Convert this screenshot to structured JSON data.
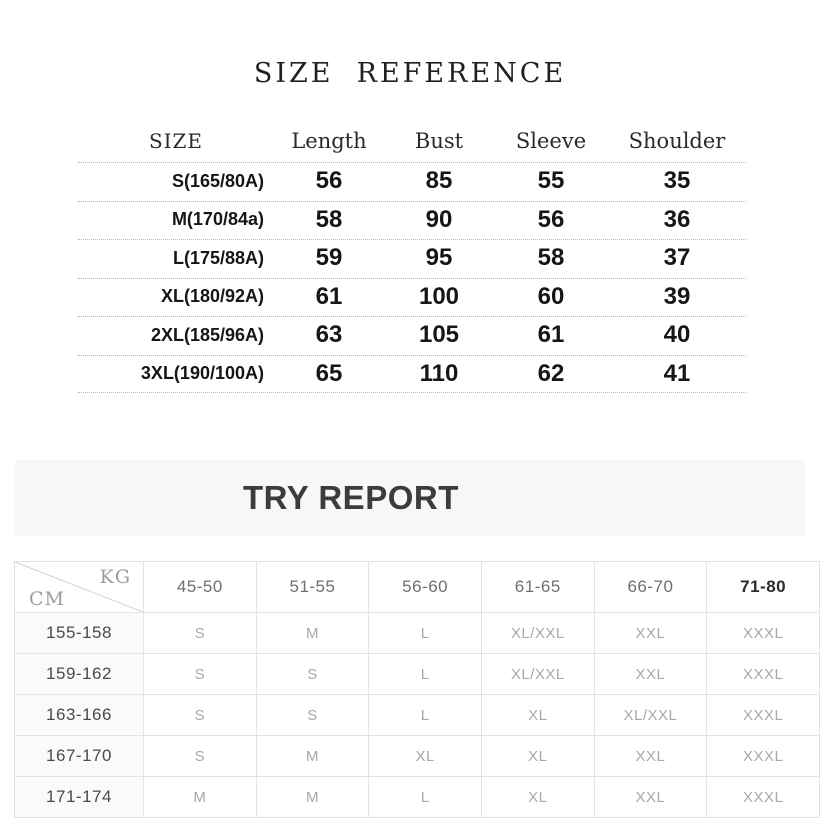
{
  "size_reference": {
    "title": "SIZE  REFERENCE",
    "columns": [
      "SIZE",
      "Length",
      "Bust",
      "Sleeve",
      "Shoulder"
    ],
    "rows": [
      {
        "size": "S(165/80A)",
        "length": "56",
        "bust": "85",
        "sleeve": "55",
        "shoulder": "35"
      },
      {
        "size": "M(170/84a)",
        "length": "58",
        "bust": "90",
        "sleeve": "56",
        "shoulder": "36"
      },
      {
        "size": "L(175/88A)",
        "length": "59",
        "bust": "95",
        "sleeve": "58",
        "shoulder": "37"
      },
      {
        "size": "XL(180/92A)",
        "length": "61",
        "bust": "100",
        "sleeve": "60",
        "shoulder": "39"
      },
      {
        "size": "2XL(185/96A)",
        "length": "63",
        "bust": "105",
        "sleeve": "61",
        "shoulder": "40"
      },
      {
        "size": "3XL(190/100A)",
        "length": "65",
        "bust": "110",
        "sleeve": "62",
        "shoulder": "41"
      }
    ]
  },
  "try_report": {
    "title": "TRY REPORT",
    "corner": {
      "weight_unit": "KG",
      "height_unit": "CM"
    },
    "weight_ranges": [
      "45-50",
      "51-55",
      "56-60",
      "61-65",
      "66-70",
      "71-80"
    ],
    "rows": [
      {
        "height": "155-158",
        "sizes": [
          "S",
          "M",
          "L",
          "XL/XXL",
          "XXL",
          "XXXL"
        ]
      },
      {
        "height": "159-162",
        "sizes": [
          "S",
          "S",
          "L",
          "XL/XXL",
          "XXL",
          "XXXL"
        ]
      },
      {
        "height": "163-166",
        "sizes": [
          "S",
          "S",
          "L",
          "XL",
          "XL/XXL",
          "XXXL"
        ]
      },
      {
        "height": "167-170",
        "sizes": [
          "S",
          "M",
          "XL",
          "XL",
          "XXL",
          "XXXL"
        ]
      },
      {
        "height": "171-174",
        "sizes": [
          "M",
          "M",
          "L",
          "XL",
          "XXL",
          "XXXL"
        ]
      }
    ]
  },
  "colors": {
    "title_text": "#231f20",
    "band_background": "#f7f7f7",
    "try_title_text": "#3c3c3c",
    "grid_line": "#e3e3e3",
    "dotted_line": "#b9b9b9",
    "muted_text": "#a8a8a8"
  }
}
